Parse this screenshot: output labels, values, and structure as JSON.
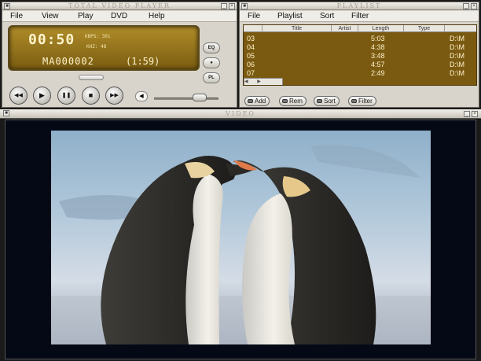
{
  "player": {
    "title": "TOTAL VIDEO PLAYER",
    "menu": [
      "File",
      "View",
      "Play",
      "DVD",
      "Help"
    ],
    "time": "00:50",
    "kbps": "KBPS: 301",
    "khz": "KHZ: 48",
    "track": "MA000002",
    "duration": "(1:59)",
    "side_buttons": [
      "EQ",
      "●",
      "PL"
    ],
    "transport": [
      "◀◀",
      "▶",
      "❚❚",
      "■",
      "▶▶"
    ],
    "volume_fraction": 0.76
  },
  "playlist": {
    "title": "PLAYLIST",
    "menu": [
      "File",
      "Playlist",
      "Sort",
      "Filter"
    ],
    "columns": [
      "",
      "Title",
      "Artist",
      "Length",
      "Type",
      ""
    ],
    "rows": [
      {
        "num": "03",
        "length": "5:03",
        "path": "D:\\M"
      },
      {
        "num": "04",
        "length": "4:38",
        "path": "D:\\M"
      },
      {
        "num": "05",
        "length": "3:48",
        "path": "D:\\M"
      },
      {
        "num": "06",
        "length": "4:57",
        "path": "D:\\M"
      },
      {
        "num": "07",
        "length": "2:49",
        "path": "D:\\M"
      }
    ],
    "buttons": [
      "Add",
      "Rem",
      "Sort",
      "Filter"
    ]
  },
  "video": {
    "title": "VIDEO"
  },
  "colors": {
    "lcd_gold": "#9a7a1e",
    "lcd_text": "#fff4cc",
    "window_gray": "#d8d4cb",
    "video_bg": "#050916"
  }
}
